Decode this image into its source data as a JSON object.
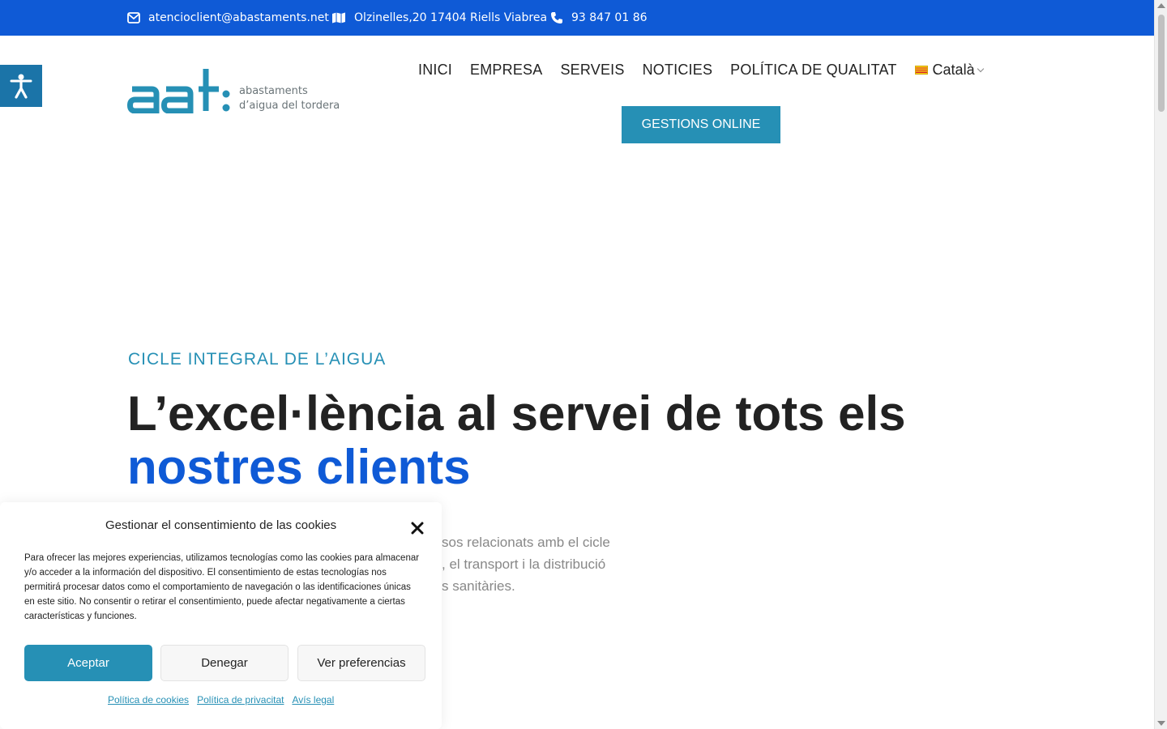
{
  "topbar": {
    "email": "atencioclient@abastaments.net",
    "address": "Olzinelles,20 17404 Riells Viabrea",
    "phone": "93 847 01 86",
    "icons": {
      "email": "envelope-icon",
      "address": "map-icon",
      "phone": "phone-icon"
    }
  },
  "logo": {
    "mark": "aat:",
    "tagline_line1": "abastaments",
    "tagline_line2": "d’aigua del tordera"
  },
  "nav": {
    "items": [
      {
        "label": "INICI"
      },
      {
        "label": "EMPRESA"
      },
      {
        "label": "SERVEIS"
      },
      {
        "label": "NOTICIES"
      },
      {
        "label": "POLÍTICA DE QUALITAT"
      }
    ],
    "language": "Català",
    "cta": "GESTIONS ONLINE"
  },
  "hero": {
    "eyebrow": "CICLE INTEGRAL DE L’AIGUA",
    "headline_part1": "L’excel·lència al servei de tots els",
    "headline_part2": "nostres clients",
    "lead_line1": "sos relacionats amb el cicle",
    "lead_line2": ", el transport i la distribució",
    "lead_line3": "s sanitàries."
  },
  "cookie_banner": {
    "title": "Gestionar el consentimiento de las cookies",
    "text": "Para ofrecer las mejores experiencias, utilizamos tecnologías como las cookies para almacenar y/o acceder a la información del dispositivo. El consentimiento de estas tecnologías nos permitirá procesar datos como el comportamiento de navegación o las identificaciones únicas en este sitio. No consentir o retirar el consentimiento, puede afectar negativamente a ciertas características y funciones.",
    "accept": "Aceptar",
    "deny": "Denegar",
    "preferences": "Ver preferencias",
    "links": [
      "Política de cookies",
      "Política de privacitat",
      "Avís legal"
    ]
  },
  "colors": {
    "topbar": "#0f5ad6",
    "brand_teal": "#2690b5",
    "headline_accent": "#0f5ad6"
  }
}
